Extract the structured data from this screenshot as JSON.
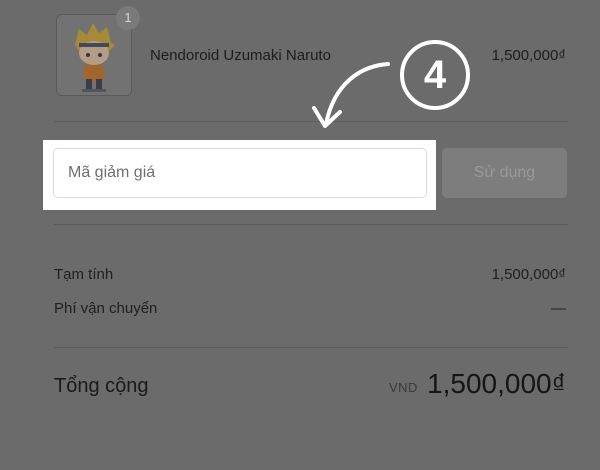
{
  "order": {
    "item": {
      "quantity": "1",
      "name": "Nendoroid Uzumaki Naruto",
      "price": "1,500,000₫"
    }
  },
  "annotation": {
    "step_number": "4"
  },
  "discount": {
    "placeholder": "Mã giảm giá",
    "apply_label": "Sử dụng"
  },
  "summary": {
    "subtotal_label": "Tạm tính",
    "subtotal_value": "1,500,000₫",
    "shipping_label": "Phí vận chuyển",
    "shipping_value": "—",
    "total_label": "Tổng cộng",
    "currency": "VND",
    "total_value": "1,500,000₫"
  },
  "colors": {
    "overlay": "#6b6b6b",
    "highlight": "#ffffff",
    "disabled_button": "#7d7d7d"
  }
}
